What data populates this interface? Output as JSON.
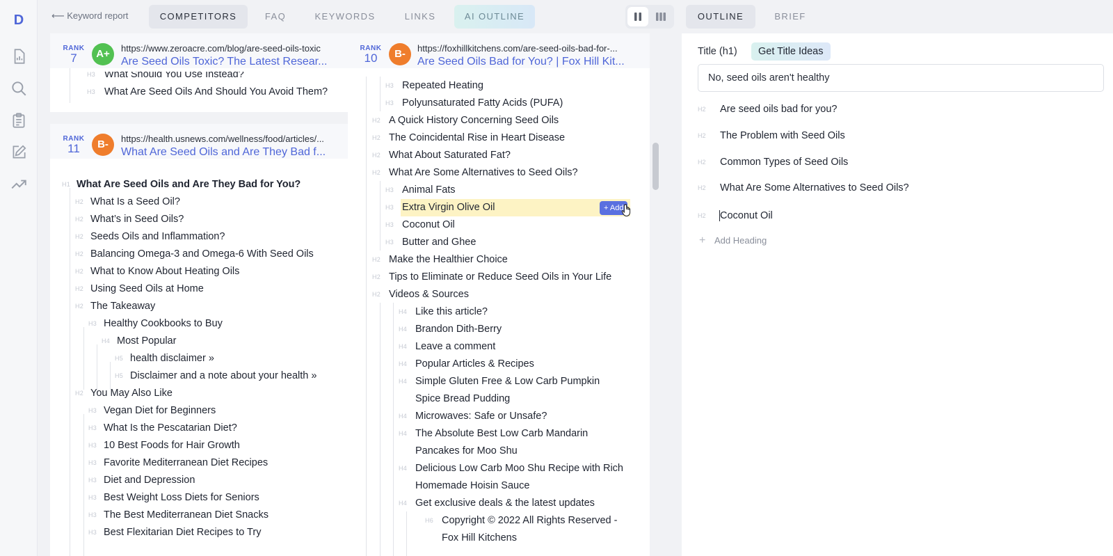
{
  "app": {
    "logo_letter": "D"
  },
  "rail_icons": [
    "chart-icon",
    "search-icon",
    "clipboard-icon",
    "edit-icon",
    "trend-icon"
  ],
  "nav": {
    "back_label": "Keyword report",
    "tabs": [
      "COMPETITORS",
      "FAQ",
      "KEYWORDS",
      "LINKS",
      "AI OUTLINE"
    ],
    "active_tab": "COMPETITORS"
  },
  "right_tabs": {
    "tabs": [
      "OUTLINE",
      "BRIEF"
    ],
    "active_tab": "OUTLINE"
  },
  "colors": {
    "accent": "#4f66d8",
    "grade_green": "#52c152",
    "grade_orange": "#ef7d2c",
    "highlight": "#fdf3c4"
  },
  "rank_label": "RANK",
  "cards": [
    {
      "rank": "7",
      "grade": "A+",
      "url": "https://www.zeroacre.com/blog/are-seed-oils-toxic",
      "title": "Are Seed Oils Toxic? The Latest Resear...",
      "headings": [
        {
          "level": "H3",
          "text": "What Should You Use Instead?"
        },
        {
          "level": "H3",
          "text": "What Are Seed Oils And Should You Avoid Them?"
        }
      ]
    },
    {
      "rank": "11",
      "grade": "B-",
      "url": "https://health.usnews.com/wellness/food/articles/...",
      "title": "What Are Seed Oils and Are They Bad f...",
      "headings": [
        {
          "level": "H1",
          "text": "What Are Seed Oils and Are They Bad for You?"
        },
        {
          "level": "H2",
          "text": "What Is a Seed Oil?"
        },
        {
          "level": "H2",
          "text": "What’s in Seed Oils?"
        },
        {
          "level": "H2",
          "text": "Seeds Oils and Inflammation?"
        },
        {
          "level": "H2",
          "text": "Balancing Omega-3 and Omega-6 With Seed Oils"
        },
        {
          "level": "H2",
          "text": "What to Know About Heating Oils"
        },
        {
          "level": "H2",
          "text": "Using Seed Oils at Home"
        },
        {
          "level": "H2",
          "text": "The Takeaway"
        },
        {
          "level": "H3",
          "text": "Healthy Cookbooks to Buy"
        },
        {
          "level": "H4",
          "text": "Most Popular"
        },
        {
          "level": "H5",
          "text": "health disclaimer »"
        },
        {
          "level": "H5",
          "text": "Disclaimer and a note about your health »"
        },
        {
          "level": "H2",
          "text": "You May Also Like"
        },
        {
          "level": "H3",
          "text": "Vegan Diet for Beginners"
        },
        {
          "level": "H3",
          "text": "What Is the Pescatarian Diet?"
        },
        {
          "level": "H3",
          "text": "10 Best Foods for Hair Growth"
        },
        {
          "level": "H3",
          "text": "Favorite Mediterranean Diet Recipes"
        },
        {
          "level": "H3",
          "text": "Diet and Depression"
        },
        {
          "level": "H3",
          "text": "Best Weight Loss Diets for Seniors"
        },
        {
          "level": "H3",
          "text": "The Best Mediterranean Diet Snacks"
        },
        {
          "level": "H3",
          "text": "Best Flexitarian Diet Recipes to Try"
        }
      ]
    },
    {
      "rank": "10",
      "grade": "B-",
      "url": "https://foxhillkitchens.com/are-seed-oils-bad-for-...",
      "title": "Are Seed Oils Bad for You? | Fox Hill Kit...",
      "headings": [
        {
          "level": "H3",
          "text": "Repeated Heating"
        },
        {
          "level": "H3",
          "text": "Polyunsaturated Fatty Acids (PUFA)"
        },
        {
          "level": "H2",
          "text": "A Quick History Concerning Seed Oils"
        },
        {
          "level": "H2",
          "text": "The Coincidental Rise in Heart Disease"
        },
        {
          "level": "H2",
          "text": "What About Saturated Fat?"
        },
        {
          "level": "H2",
          "text": "What Are Some Alternatives to Seed Oils?"
        },
        {
          "level": "H3",
          "text": "Animal Fats"
        },
        {
          "level": "H3",
          "text": "Extra Virgin Olive Oil"
        },
        {
          "level": "H3",
          "text": "Coconut Oil"
        },
        {
          "level": "H3",
          "text": "Butter and Ghee"
        },
        {
          "level": "H2",
          "text": "Make the Healthier Choice"
        },
        {
          "level": "H2",
          "text": "Tips to Eliminate or Reduce Seed Oils in Your Life"
        },
        {
          "level": "H2",
          "text": "Videos & Sources"
        },
        {
          "level": "H4",
          "text": "Like this article?"
        },
        {
          "level": "H4",
          "text": "Brandon Dith-Berry"
        },
        {
          "level": "H4",
          "text": "Leave a comment"
        },
        {
          "level": "H4",
          "text": "Popular Articles & Recipes"
        },
        {
          "level": "H4",
          "text": "Simple Gluten Free & Low Carb Pumpkin"
        },
        {
          "level": "",
          "text": "Spice Bread Pudding"
        },
        {
          "level": "H4",
          "text": "Microwaves: Safe or Unsafe?"
        },
        {
          "level": "H4",
          "text": "The Absolute Best Low Carb Mandarin"
        },
        {
          "level": "",
          "text": "Pancakes for Moo Shu"
        },
        {
          "level": "H4",
          "text": "Delicious Low Carb Moo Shu Recipe with Rich"
        },
        {
          "level": "",
          "text": "Homemade Hoisin Sauce"
        },
        {
          "level": "H4",
          "text": "Get exclusive deals & the latest updates"
        },
        {
          "level": "H6",
          "text": "Copyright © 2022 All Rights Reserved -"
        },
        {
          "level": "",
          "text": "Fox Hill Kitchens"
        }
      ],
      "add_button_label": "+ Add"
    }
  ],
  "outline": {
    "title_label": "Title (h1)",
    "get_ideas_label": "Get Title Ideas",
    "title_value": "No, seed oils aren't healthy",
    "headings": [
      {
        "level": "H2",
        "text": "Are seed oils bad for you?"
      },
      {
        "level": "H2",
        "text": "The Problem with Seed Oils"
      },
      {
        "level": "H2",
        "text": "Common Types of Seed Oils"
      },
      {
        "level": "H2",
        "text": "What Are Some Alternatives to Seed Oils?"
      },
      {
        "level": "H2",
        "text": "Coconut Oil"
      }
    ],
    "add_heading_label": "Add Heading"
  }
}
